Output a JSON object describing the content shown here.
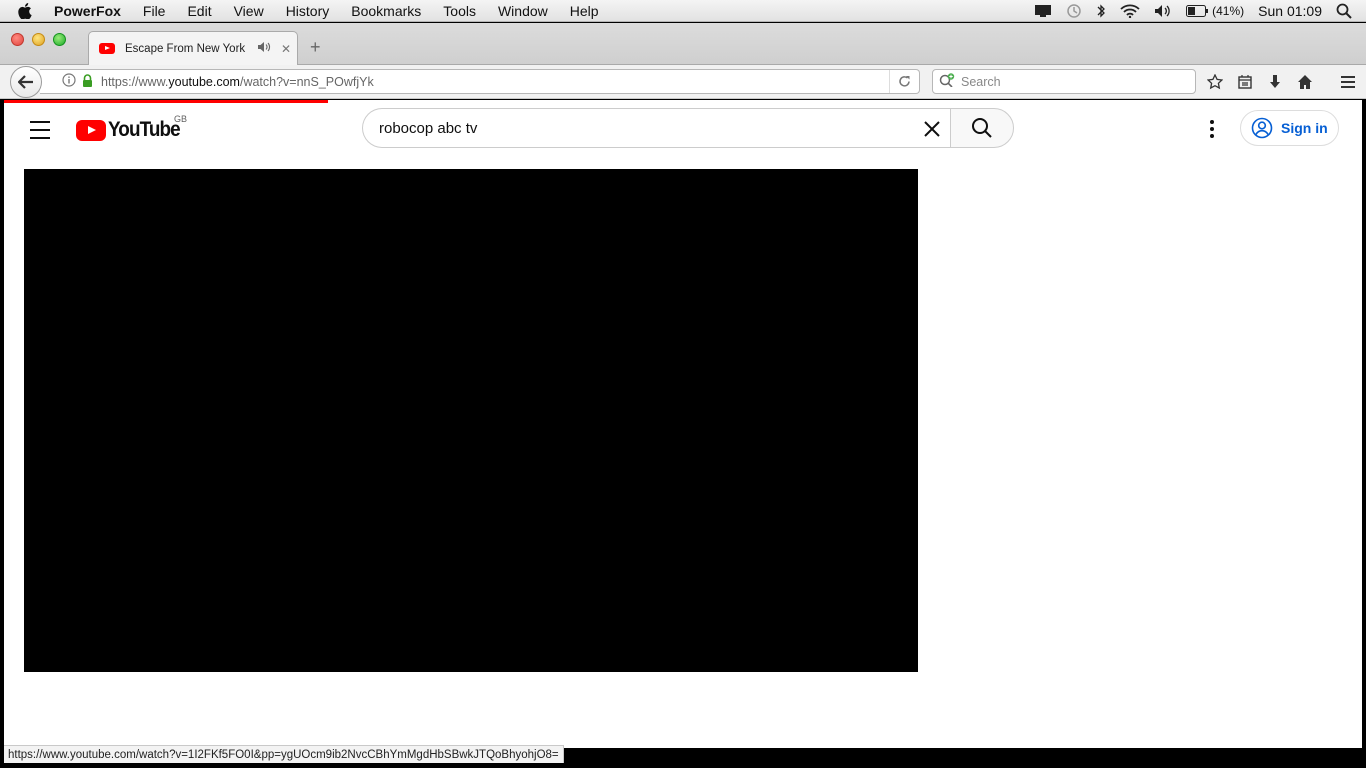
{
  "menubar": {
    "app_name": "PowerFox",
    "items": [
      "File",
      "Edit",
      "View",
      "History",
      "Bookmarks",
      "Tools",
      "Window",
      "Help"
    ],
    "battery_pct": "(41%)",
    "clock": "Sun 01:09"
  },
  "tab": {
    "title": "Escape From New York",
    "new_tab_label": "+"
  },
  "navbar": {
    "url_prefix": "https://www.",
    "url_host": "youtube.com",
    "url_path": "/watch?v=nnS_POwfjYk",
    "search_placeholder": "Search"
  },
  "youtube": {
    "logo_text": "YouTube",
    "country_code": "GB",
    "search_query": "robocop abc tv",
    "signin_label": "Sign in",
    "load_progress": 0.24
  },
  "statusbar": {
    "link": "https://www.youtube.com/watch?v=1I2FKf5FO0I&pp=ygUOcm9ib2NvcCBhYmMgdHbSBwkJTQoBhyohjO8="
  },
  "colors": {
    "youtube_red": "#ff0000",
    "signin_blue": "#065fd4",
    "lock_green": "#3a9d23"
  }
}
